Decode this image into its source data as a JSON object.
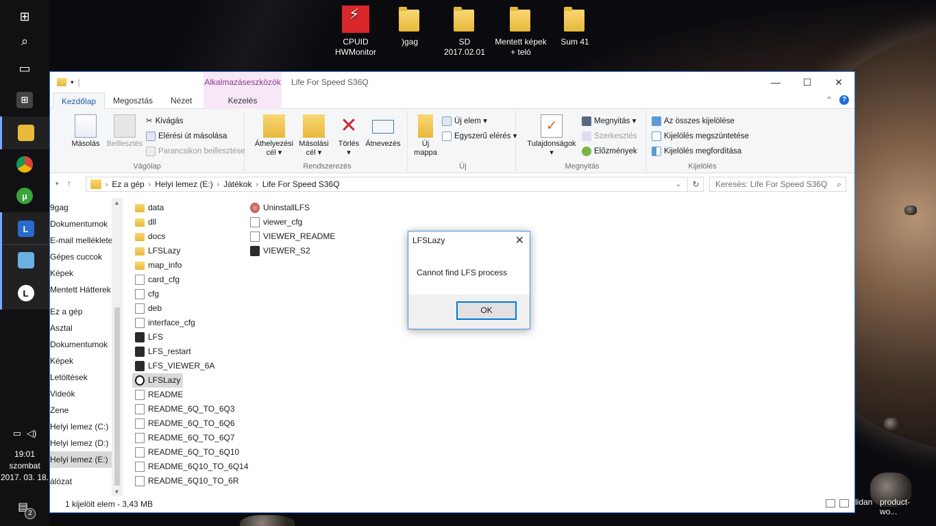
{
  "desktop": {
    "icons": [
      {
        "label_lines": [
          "CPUID",
          "HWMonitor"
        ]
      },
      {
        "label_lines": [
          ")gag"
        ]
      },
      {
        "label_lines": [
          "SD 2017.02.01"
        ]
      },
      {
        "label_lines": [
          "Mentett képek",
          "+ teló"
        ]
      },
      {
        "label_lines": [
          "Sum 41"
        ]
      }
    ],
    "bottom_right": [
      "lidan",
      "product-wo..."
    ]
  },
  "taskbar": {
    "time": "19:01",
    "day": "szombat",
    "date": "2017. 03. 18.",
    "notification_count": "2"
  },
  "window": {
    "title": "Life For Speed S36Q",
    "context_tab_group": "Alkalmazáseszközök",
    "tabs": [
      "Kezdőlap",
      "Megosztás",
      "Nézet",
      "Kezelés"
    ],
    "ribbon": {
      "clipboard": {
        "label": "Vágólap",
        "copy": "Másolás",
        "paste": "Beillesztés",
        "cut": "Kivágás",
        "copy_path": "Elérési út másolása",
        "paste_shortcut": "Parancsikon beillesztése"
      },
      "organize": {
        "label": "Rendszerezés",
        "move_to": [
          "Áthelyezési",
          "cél ▾"
        ],
        "copy_to": [
          "Másolási",
          "cél ▾"
        ],
        "delete": [
          "Törlés",
          "▾"
        ],
        "rename": "Átnevezés"
      },
      "new": {
        "label": "Új",
        "new_folder": [
          "Új",
          "mappa"
        ],
        "new_item": "Új elem ▾",
        "easy_access": "Egyszerű elérés ▾"
      },
      "open": {
        "label": "Megnyitás",
        "properties": [
          "Tulajdonságok",
          "▾"
        ],
        "open": "Megnyitás ▾",
        "edit": "Szerkesztés",
        "history": "Előzmények"
      },
      "select": {
        "label": "Kijelölés",
        "select_all": "Az összes kijelölése",
        "select_none": "Kijelölés megszüntetése",
        "invert": "Kijelölés megfordítása"
      }
    },
    "breadcrumb": [
      "Ez a gép",
      "Helyi lemez (E:)",
      "Játékok",
      "Life For Speed S36Q"
    ],
    "search_placeholder": "Keresés: Life For Speed S36Q",
    "nav_items": [
      "9gag",
      "Dokumentumok",
      "E-mail melléklete",
      "Gépes cuccok",
      "Képek",
      "Mentett Hátterek",
      "Ez a gép",
      "Asztal",
      "Dokumentumok",
      "Képek",
      "Letöltések",
      "Videók",
      "Zene",
      "Helyi lemez (C:)",
      "Helyi lemez (D:)",
      "Helyi lemez (E:)",
      "álózat"
    ],
    "files_col1": [
      {
        "name": "data",
        "type": "folder"
      },
      {
        "name": "dll",
        "type": "folder"
      },
      {
        "name": "docs",
        "type": "folder"
      },
      {
        "name": "LFSLazy",
        "type": "folder"
      },
      {
        "name": "map_info",
        "type": "folder"
      },
      {
        "name": "card_cfg",
        "type": "doc"
      },
      {
        "name": "cfg",
        "type": "doc"
      },
      {
        "name": "deb",
        "type": "doc"
      },
      {
        "name": "interface_cfg",
        "type": "doc"
      },
      {
        "name": "LFS",
        "type": "exe"
      },
      {
        "name": "LFS_restart",
        "type": "exe"
      },
      {
        "name": "LFS_VIEWER_6A",
        "type": "exe"
      },
      {
        "name": "LFSLazy",
        "type": "lazy"
      },
      {
        "name": "README",
        "type": "doc"
      },
      {
        "name": "README_6Q_TO_6Q3",
        "type": "doc"
      },
      {
        "name": "README_6Q_TO_6Q6",
        "type": "doc"
      },
      {
        "name": "README_6Q_TO_6Q7",
        "type": "doc"
      },
      {
        "name": "README_6Q_TO_6Q10",
        "type": "doc"
      },
      {
        "name": "README_6Q10_TO_6Q14",
        "type": "doc"
      },
      {
        "name": "README_6Q10_TO_6R",
        "type": "doc"
      }
    ],
    "files_col2": [
      {
        "name": "UninstallLFS",
        "type": "uninst"
      },
      {
        "name": "viewer_cfg",
        "type": "doc"
      },
      {
        "name": "VIEWER_README",
        "type": "doc"
      },
      {
        "name": "VIEWER_S2",
        "type": "exe"
      }
    ],
    "status": "1 kijelölt elem - 3,43 MB"
  },
  "dialog": {
    "title": "LFSLazy",
    "message": "Cannot find LFS process",
    "ok": "OK"
  },
  "colors": {
    "accent": "#1e5aa8",
    "context_tab": "#f7e7f7",
    "selection": "#d9d9d9"
  }
}
